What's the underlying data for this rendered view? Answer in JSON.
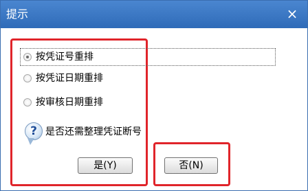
{
  "window": {
    "title": "提示",
    "close_label": "×"
  },
  "options": [
    {
      "label": "按凭证号重排",
      "selected": true
    },
    {
      "label": "按凭证日期重排",
      "selected": false
    },
    {
      "label": "按审核日期重排",
      "selected": false
    }
  ],
  "prompt": {
    "icon": "question-icon",
    "text": "是否还需整理凭证断号"
  },
  "buttons": {
    "yes_label": "是(Y)",
    "no_label": "否(N)"
  },
  "colors": {
    "titlebar": "#2f6bb8",
    "highlight_box": "#e0242a"
  }
}
